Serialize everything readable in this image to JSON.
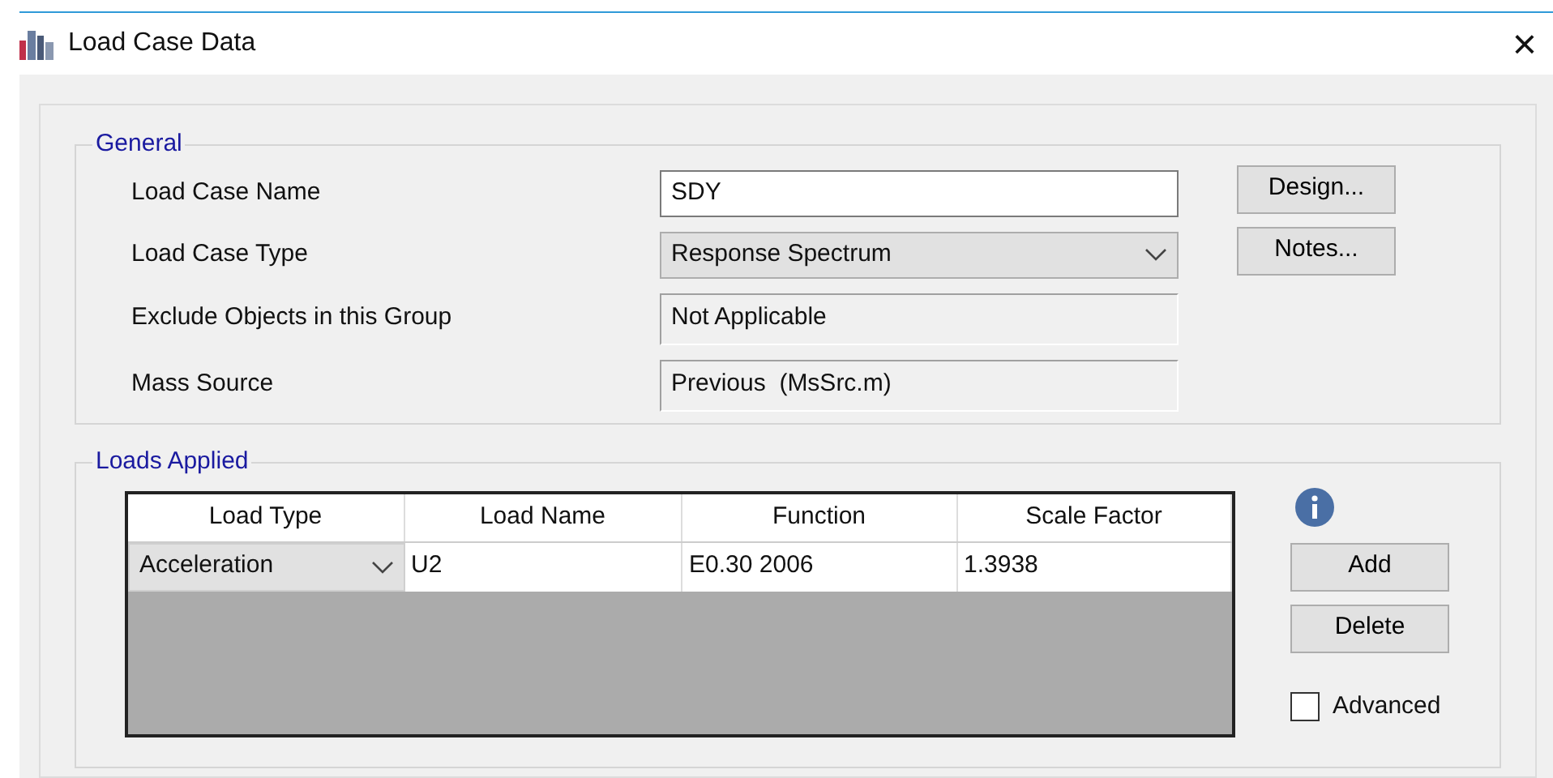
{
  "window": {
    "title": "Load Case Data",
    "close": "×"
  },
  "general": {
    "legend": "General",
    "fields": [
      {
        "label": "Load Case Name",
        "kind": "text",
        "value": "SDY"
      },
      {
        "label": "Load Case Type",
        "kind": "dropdown",
        "value": "Response Spectrum"
      },
      {
        "label": "Exclude Objects in this Group",
        "kind": "readonly",
        "value": "Not Applicable"
      },
      {
        "label": "Mass Source",
        "kind": "readonly",
        "value": "Previous  (MsSrc.m)"
      }
    ],
    "buttons": [
      "Design...",
      "Notes..."
    ]
  },
  "loads_applied": {
    "legend": "Loads Applied",
    "table": {
      "columns": [
        "Load Type",
        "Load Name",
        "Function",
        "Scale Factor"
      ],
      "rows": [
        [
          "Acceleration",
          "U2",
          "E0.30 2006",
          "1.3938"
        ]
      ]
    },
    "buttons": [
      "Add",
      "Delete"
    ],
    "advanced": {
      "label": "Advanced",
      "checked": false
    }
  }
}
